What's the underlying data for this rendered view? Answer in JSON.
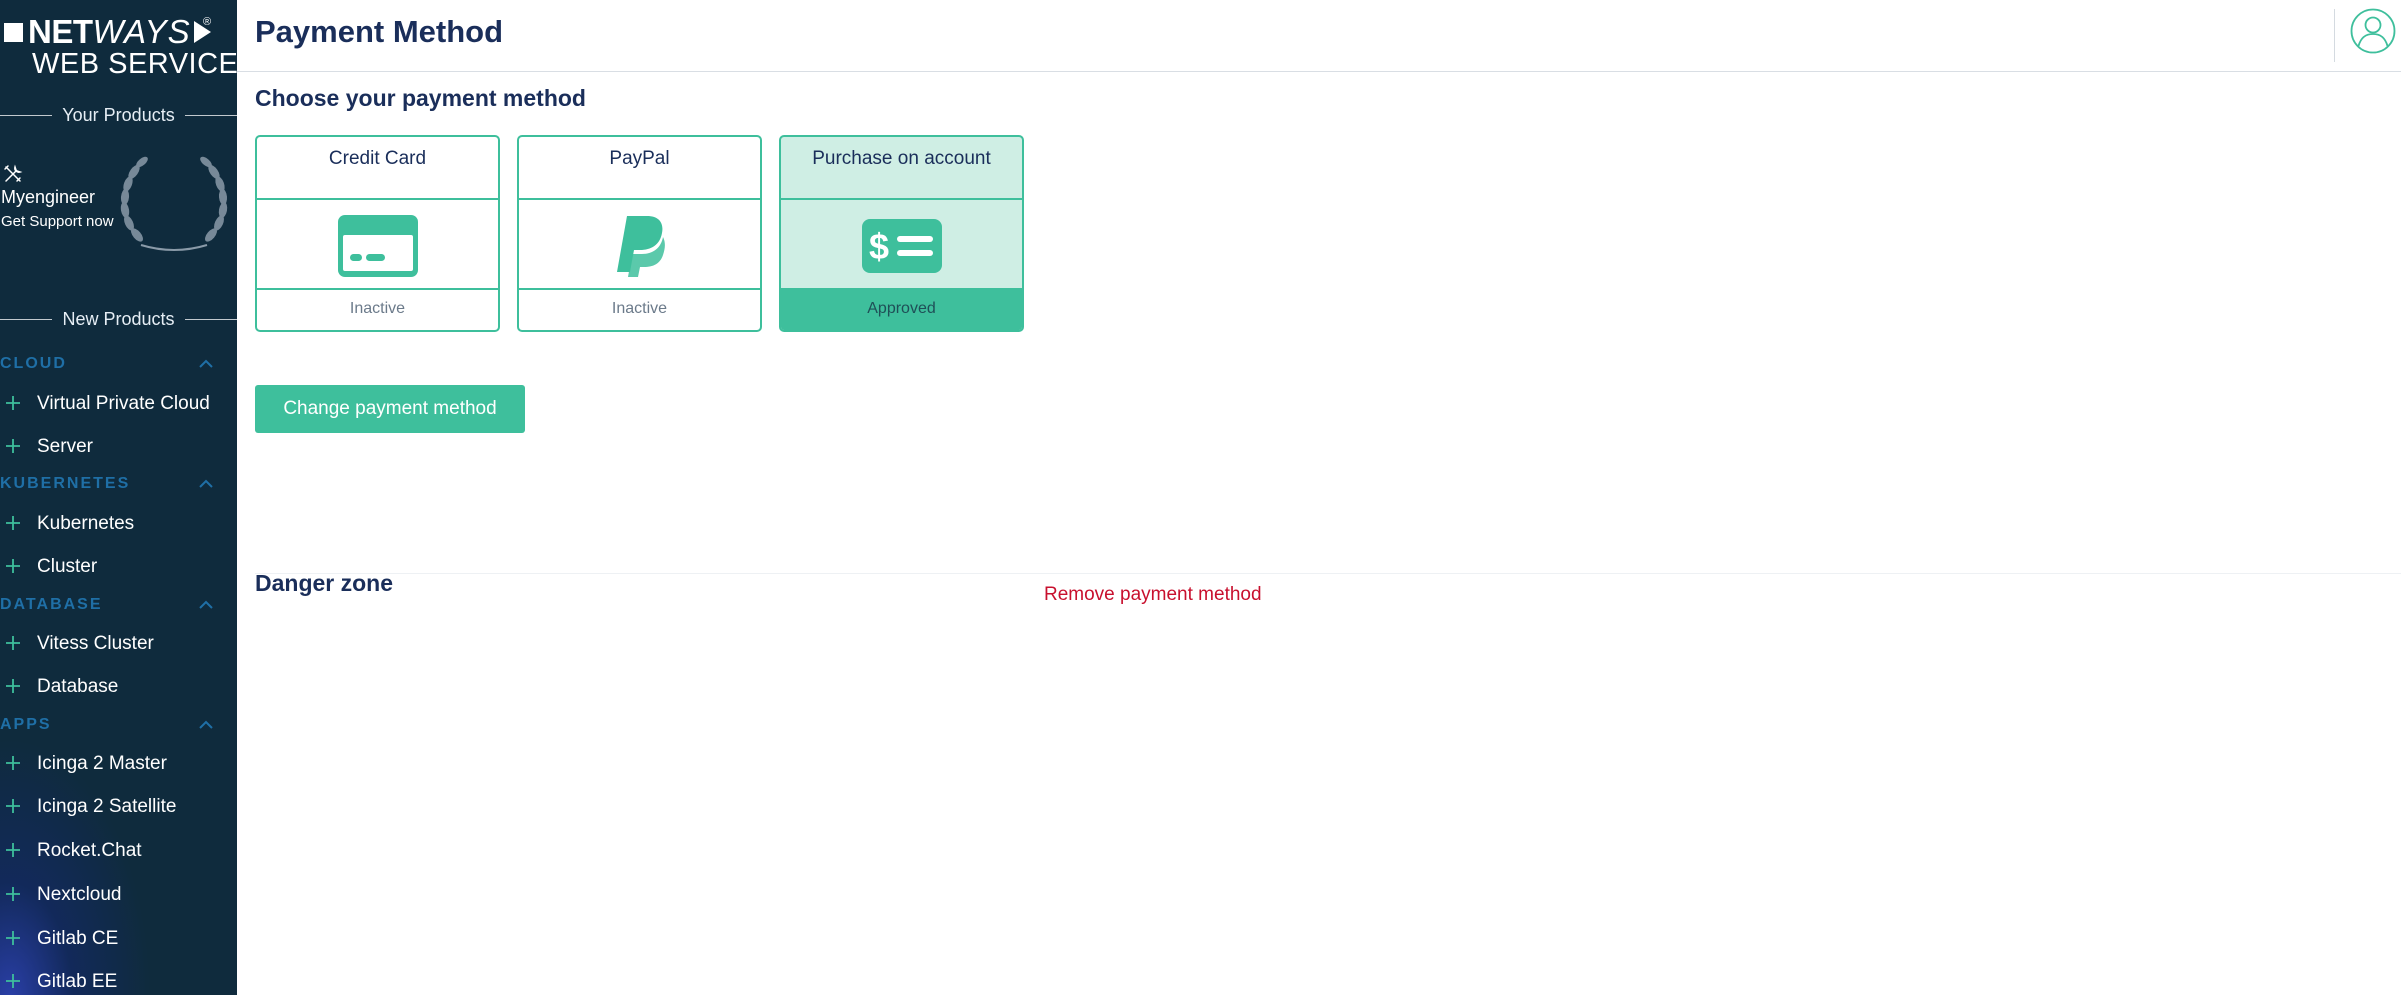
{
  "brand": {
    "line1_bold": "NET",
    "line1_italic": "WAYS",
    "registered": "®",
    "line2": "WEB SERVICES"
  },
  "sidebar": {
    "your_products_heading": "Your Products",
    "product": {
      "name": "Myengineer",
      "subtitle": "Get Support now",
      "icon": "tools-icon"
    },
    "new_products_heading": "New Products",
    "categories": [
      {
        "label": "CLOUD",
        "items": [
          "Virtual Private Cloud",
          "Server"
        ]
      },
      {
        "label": "KUBERNETES",
        "items": [
          "Kubernetes",
          "Cluster"
        ]
      },
      {
        "label": "DATABASE",
        "items": [
          "Vitess Cluster",
          "Database"
        ]
      },
      {
        "label": "APPS",
        "items": [
          "Icinga 2 Master",
          "Icinga 2 Satellite",
          "Rocket.Chat",
          "Nextcloud",
          "Gitlab CE",
          "Gitlab EE"
        ]
      }
    ]
  },
  "header": {
    "title": "Payment Method",
    "avatar_icon": "user-avatar-icon"
  },
  "main": {
    "subtitle": "Choose your payment method",
    "payment_methods": [
      {
        "title": "Credit Card",
        "status": "Inactive",
        "icon": "credit-card-icon",
        "selected": false
      },
      {
        "title": "PayPal",
        "status": "Inactive",
        "icon": "paypal-icon",
        "selected": false
      },
      {
        "title": "Purchase on account",
        "status": "Approved",
        "icon": "invoice-dollar-icon",
        "selected": true
      }
    ],
    "change_button": "Change payment method",
    "danger_zone_title": "Danger zone",
    "remove_link": "Remove payment method"
  },
  "colors": {
    "sidebar_bg": "#0f2b3d",
    "accent": "#3ebf9c",
    "accent_light": "#cfeee4",
    "heading": "#1a2e5a",
    "category": "#1f6fa6",
    "danger": "#c8102e"
  }
}
